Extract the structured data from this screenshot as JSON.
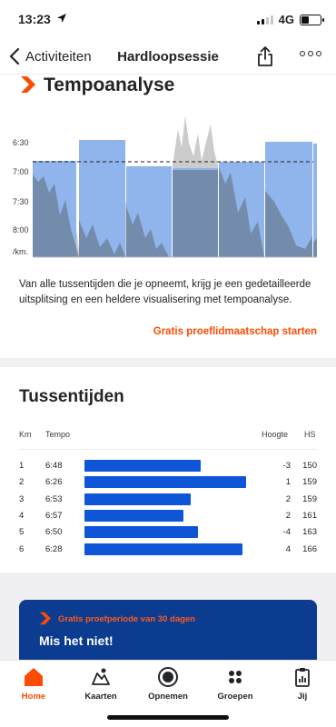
{
  "status_bar": {
    "time": "13:23",
    "network": "4G"
  },
  "nav": {
    "back_label": "Activiteiten",
    "title": "Hardloopsessie"
  },
  "tempo": {
    "title": "Tempoanalyse",
    "y_ticks": [
      "6:30",
      "7:00",
      "7:30",
      "8:00",
      "/km."
    ],
    "description": "Van alle tussentijden die je opneemt, krijg je een gedetailleerde uitsplitsing en een heldere visualisering met tempoanalyse.",
    "cta": "Gratis proeflidmaatschap starten"
  },
  "splits": {
    "title": "Tussentijden",
    "headers": {
      "km": "Km",
      "tempo": "Tempo",
      "hoogte": "Hoogte",
      "hs": "HS"
    },
    "rows": [
      {
        "km": "1",
        "tempo": "6:48",
        "hoogte": "-3",
        "hs": "150",
        "bar_fraction": 0.72
      },
      {
        "km": "2",
        "tempo": "6:26",
        "hoogte": "1",
        "hs": "159",
        "bar_fraction": 1.0
      },
      {
        "km": "3",
        "tempo": "6:53",
        "hoogte": "2",
        "hs": "159",
        "bar_fraction": 0.66
      },
      {
        "km": "4",
        "tempo": "6:57",
        "hoogte": "2",
        "hs": "161",
        "bar_fraction": 0.61
      },
      {
        "km": "5",
        "tempo": "6:50",
        "hoogte": "-4",
        "hs": "163",
        "bar_fraction": 0.7
      },
      {
        "km": "6",
        "tempo": "6:28",
        "hoogte": "4",
        "hs": "166",
        "bar_fraction": 0.98
      }
    ]
  },
  "promo": {
    "small": "Gratis proefperiode van 30 dagen",
    "big": "Mis het niet!"
  },
  "tabs": [
    {
      "label": "Home",
      "icon": "home-icon",
      "active": true
    },
    {
      "label": "Kaarten",
      "icon": "map-icon",
      "active": false
    },
    {
      "label": "Opnemen",
      "icon": "record-icon",
      "active": false
    },
    {
      "label": "Groepen",
      "icon": "groups-icon",
      "active": false
    },
    {
      "label": "Jij",
      "icon": "you-icon",
      "active": false
    }
  ],
  "colors": {
    "accent": "#fc4c02",
    "bar_blue": "#0e55d8",
    "chart_bar": "#90b4ec",
    "chart_area": "#6b7f96",
    "promo_bg": "#0c3c8f"
  }
}
